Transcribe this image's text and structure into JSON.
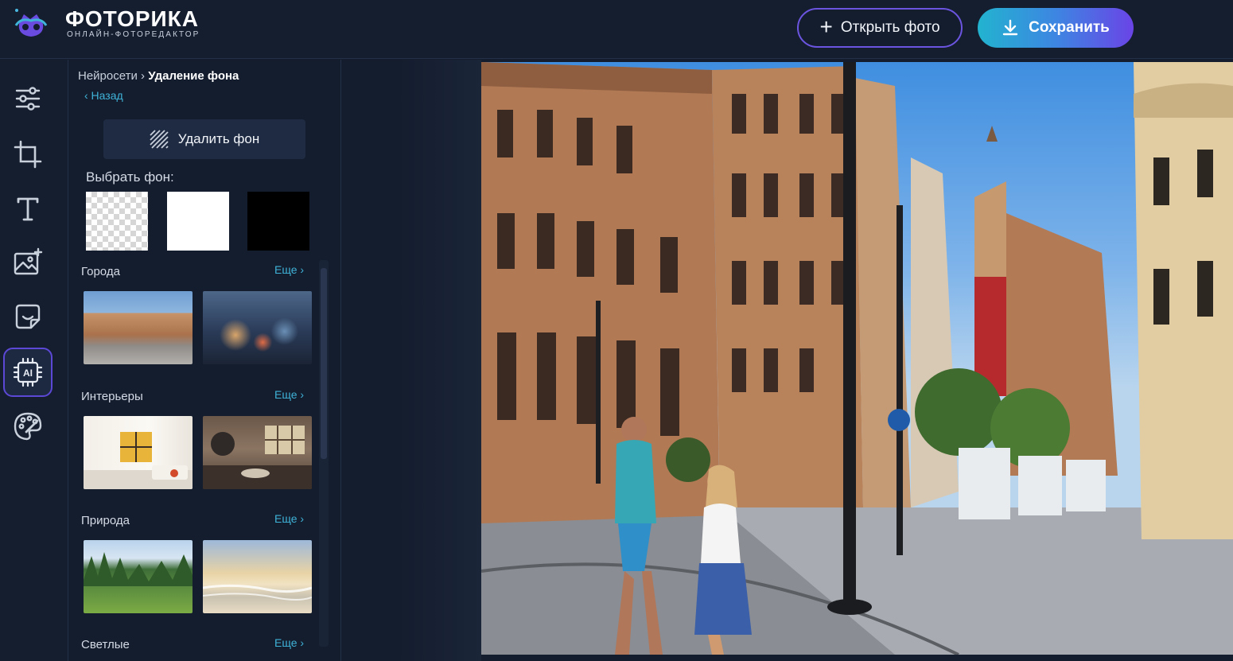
{
  "app": {
    "title": "ФОТОРИКА",
    "subtitle": "ОНЛАЙН-ФОТОРЕДАКТОР"
  },
  "header": {
    "open_label": "Открыть фото",
    "save_label": "Сохранить"
  },
  "rail": {
    "items": [
      "adjust",
      "crop",
      "text",
      "add-image",
      "sticker",
      "ai",
      "palette"
    ],
    "active": "ai"
  },
  "panel": {
    "breadcrumb_parent": "Нейросети",
    "breadcrumb_sep": "›",
    "breadcrumb_current": "Удаление фона",
    "back_label": "‹ Назад",
    "remove_bg_label": "Удалить фон",
    "pick_bg_label": "Выбрать фон:",
    "categories": [
      {
        "title": "Города",
        "more": "Еще ›"
      },
      {
        "title": "Интерьеры",
        "more": "Еще ›"
      },
      {
        "title": "Природа",
        "more": "Еще ›"
      },
      {
        "title": "Светлые",
        "more": "Еще ›"
      }
    ]
  },
  "colors": {
    "accent_cyan": "#3fb3d8",
    "accent_purple": "#6b55e0",
    "bg": "#141d2e"
  }
}
